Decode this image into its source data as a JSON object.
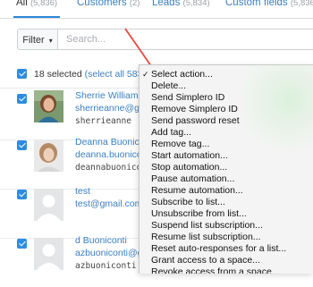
{
  "tabs": [
    {
      "label": "All",
      "count": "(5,836)"
    },
    {
      "label": "Customers",
      "count": "(2)"
    },
    {
      "label": "Leads",
      "count": "(5,834)"
    },
    {
      "label": "Custom fields",
      "count": "(5,836)"
    }
  ],
  "filter": {
    "label": "Filter",
    "search_placeholder": "Search..."
  },
  "selection": {
    "text": "18 selected",
    "select_all": "(select all 5836"
  },
  "rows": [
    {
      "name": "Sherrie Williams",
      "email": "sherrieanne@gm",
      "handle": "sherrieanne"
    },
    {
      "name": "Deanna Buonico",
      "email": "deanna.buonico",
      "handle": "deannabuonicon"
    },
    {
      "name": "test",
      "email": "test@gmail.com",
      "handle": ""
    },
    {
      "name": "d Buoniconti",
      "email": "azbuoniconti@g",
      "handle": "azbuoniconti"
    }
  ],
  "menu": {
    "items": [
      "Select action...",
      "Delete...",
      "Send Simplero ID",
      "Remove Simplero ID",
      "Send password reset",
      "Add tag...",
      "Remove tag...",
      "Start automation...",
      "Stop automation...",
      "Pause automation...",
      "Resume automation...",
      "Subscribe to list...",
      "Unsubscribe from list...",
      "Suspend list subscription...",
      "Resume list subscription...",
      "Reset auto-responses for a list...",
      "Grant access to a space...",
      "Revoke access from a space..."
    ],
    "check_glyph": "✓"
  },
  "colors": {
    "accent": "#2d8ce0",
    "link": "#3a7fc1",
    "annotation": "#e8483b"
  }
}
